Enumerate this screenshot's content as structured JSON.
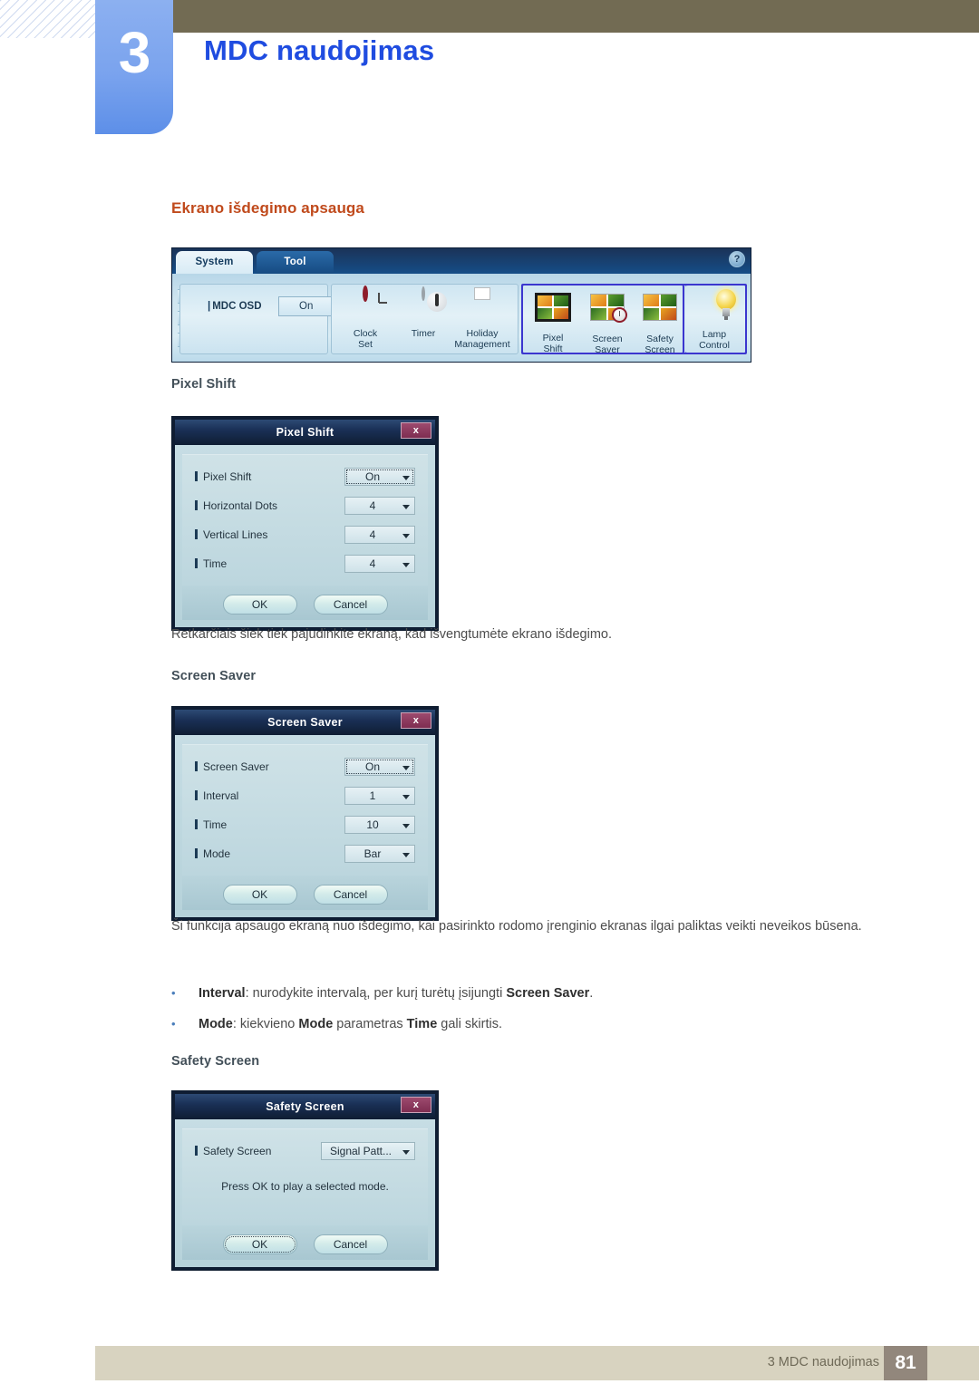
{
  "header": {
    "chapter_number": "3",
    "chapter_title": "MDC naudojimas"
  },
  "section": {
    "heading": "Ekrano išdegimo apsauga"
  },
  "toolbar": {
    "tabs": [
      {
        "label": "System",
        "active": true
      },
      {
        "label": "Tool",
        "active": false
      }
    ],
    "help_label": "?",
    "osd": {
      "label": "MDC OSD",
      "value": "On"
    },
    "items": [
      {
        "icon": "clock-icon",
        "line1": "Clock",
        "line2": "Set"
      },
      {
        "icon": "timer-icon",
        "line1": "Timer",
        "line2": ""
      },
      {
        "icon": "calendar-icon",
        "line1": "Holiday",
        "line2": "Management"
      },
      {
        "icon": "pixel-shift-icon",
        "line1": "Pixel",
        "line2": "Shift"
      },
      {
        "icon": "screen-saver-icon",
        "line1": "Screen",
        "line2": "Saver"
      },
      {
        "icon": "safety-screen-icon",
        "line1": "Safety",
        "line2": "Screen"
      },
      {
        "icon": "lamp-icon",
        "line1": "Lamp",
        "line2": "Control"
      }
    ],
    "highlight_color": "#3b36cf"
  },
  "pixel_shift": {
    "subheading": "Pixel Shift",
    "dialog": {
      "title": "Pixel Shift",
      "close_label": "x",
      "rows": [
        {
          "label": "Pixel Shift",
          "value": "On"
        },
        {
          "label": "Horizontal Dots",
          "value": "4"
        },
        {
          "label": "Vertical Lines",
          "value": "4"
        },
        {
          "label": "Time",
          "value": "4"
        }
      ],
      "ok_label": "OK",
      "cancel_label": "Cancel"
    },
    "paragraph": "Retkarčiais šiek tiek pajudinkite ekraną, kad išvengtumėte ekrano išdegimo."
  },
  "screen_saver": {
    "subheading": "Screen Saver",
    "dialog": {
      "title": "Screen Saver",
      "close_label": "x",
      "rows": [
        {
          "label": "Screen Saver",
          "value": "On"
        },
        {
          "label": "Interval",
          "value": "1"
        },
        {
          "label": "Time",
          "value": "10"
        },
        {
          "label": "Mode",
          "value": "Bar"
        }
      ],
      "ok_label": "OK",
      "cancel_label": "Cancel"
    },
    "paragraph": "Ši funkcija apsaugo ekraną nuo išdegimo, kai pasirinkto rodomo įrenginio ekranas ilgai paliktas veikti neveikos būsena.",
    "bullets": [
      {
        "parts": [
          {
            "text": "Interval",
            "bold": true
          },
          {
            "text": ": nurodykite intervalą, per kurį turėtų įsijungti ",
            "bold": false
          },
          {
            "text": "Screen Saver",
            "bold": true
          },
          {
            "text": ".",
            "bold": false
          }
        ]
      },
      {
        "parts": [
          {
            "text": "Mode",
            "bold": true
          },
          {
            "text": ": kiekvieno ",
            "bold": false
          },
          {
            "text": "Mode",
            "bold": true
          },
          {
            "text": " parametras ",
            "bold": false
          },
          {
            "text": "Time",
            "bold": true
          },
          {
            "text": " gali skirtis.",
            "bold": false
          }
        ]
      }
    ]
  },
  "safety_screen": {
    "subheading": "Safety Screen",
    "dialog": {
      "title": "Safety Screen",
      "close_label": "x",
      "rows": [
        {
          "label": "Safety Screen",
          "value": "Signal Patt..."
        }
      ],
      "note": "Press OK to play a selected mode.",
      "ok_label": "OK",
      "cancel_label": "Cancel"
    }
  },
  "footer": {
    "text": "3 MDC naudojimas",
    "page": "81"
  },
  "colors": {
    "accent_heading": "#c04a1c",
    "chapter_title": "#1f4ce0",
    "olive_bar": "#726b53",
    "footer_band": "#d8d3c0",
    "footer_page_box": "#92877c"
  }
}
